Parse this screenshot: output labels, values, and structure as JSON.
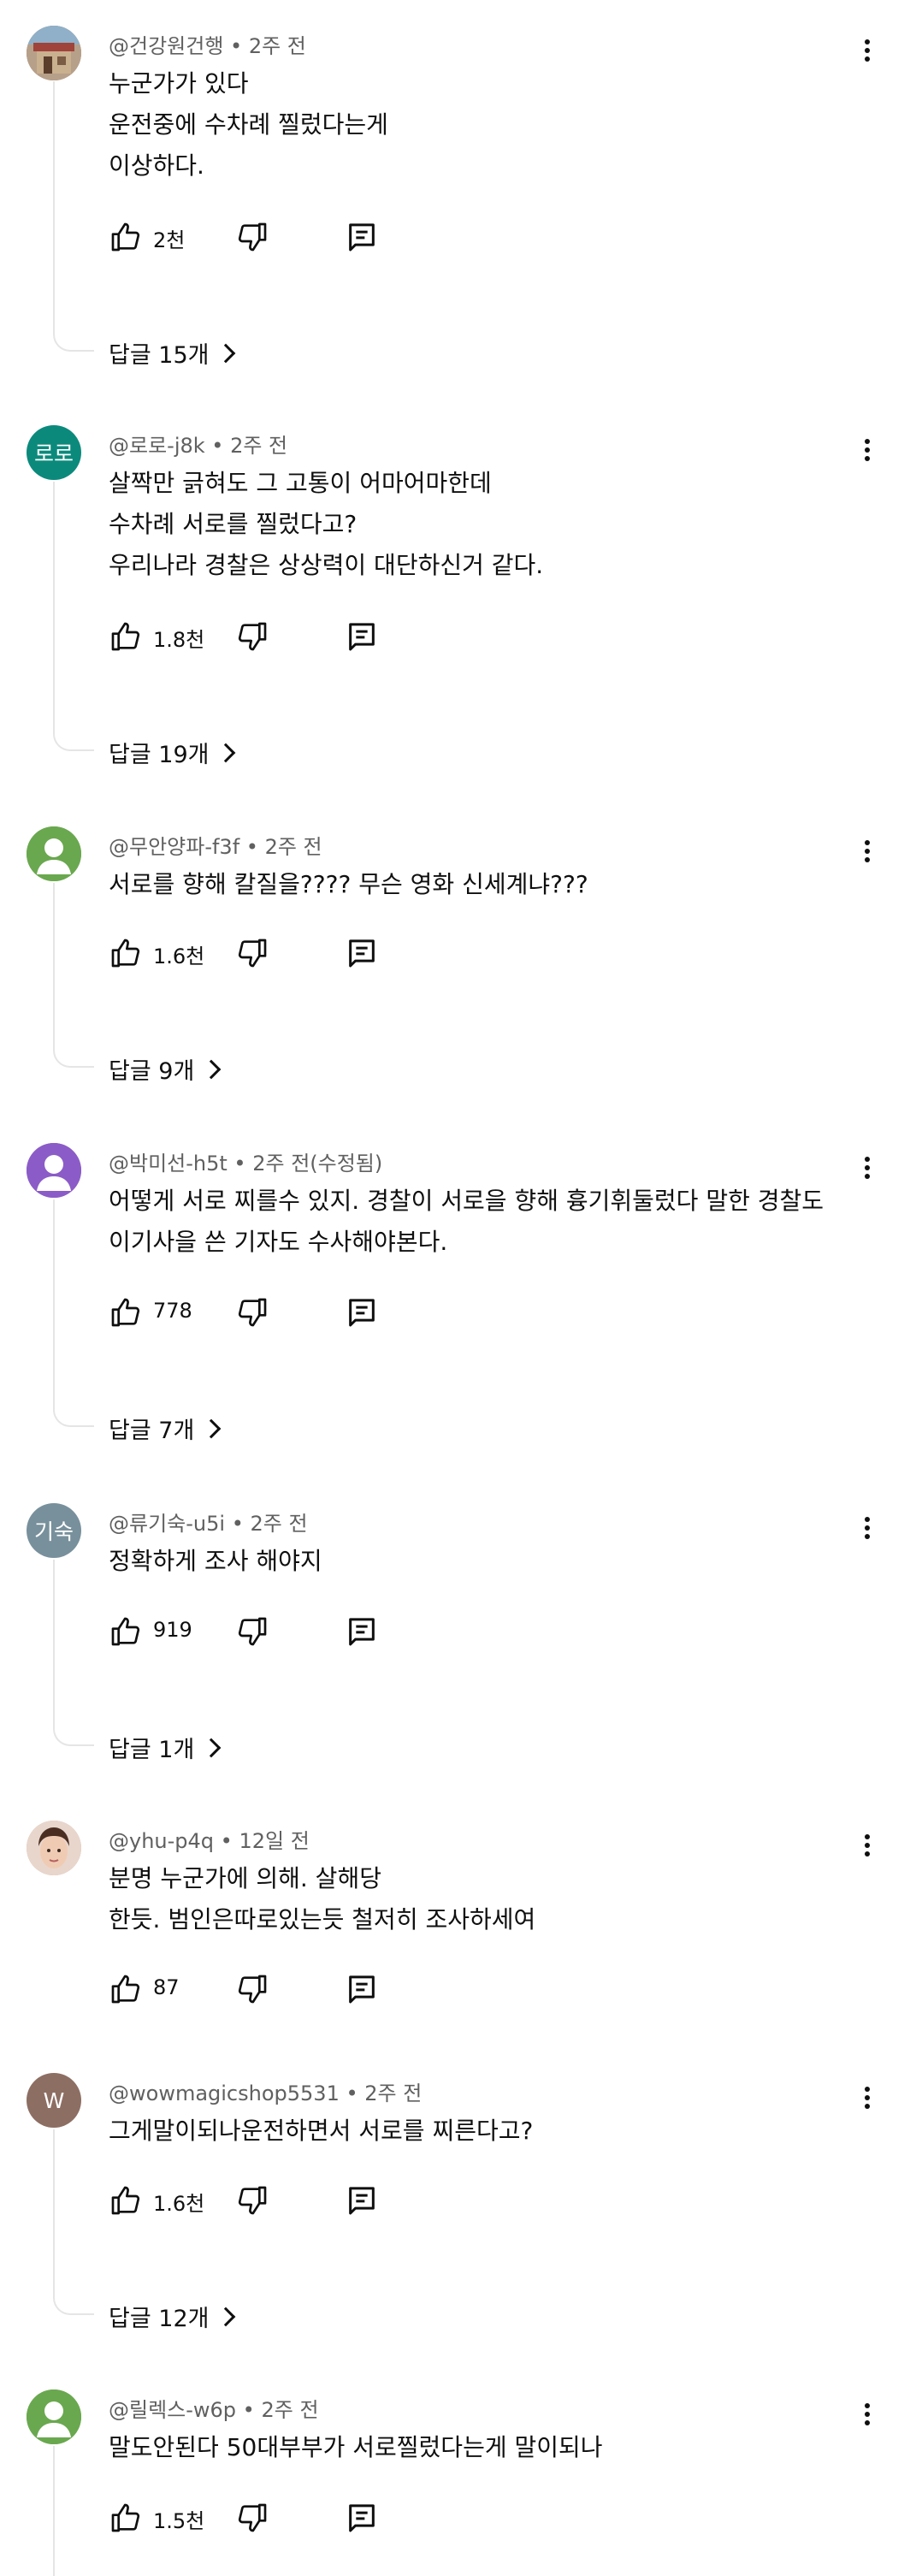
{
  "comments": [
    {
      "author": "@건강원건행",
      "time": "2주 전",
      "avatar_type": "photo-house",
      "avatar_color": "#8a6a5a",
      "lines": [
        "누군가가 있다",
        "운전중에 수차례 찔렀다는게",
        "이상하다."
      ],
      "likes": "2천",
      "replies_label": "답글 15개"
    },
    {
      "author": "@로로-j8k",
      "time": "2주 전",
      "avatar_type": "text",
      "avatar_text": "로로",
      "avatar_color": "#0b8a7c",
      "lines": [
        "살짝만 긁혀도 그 고통이 어마어마한데",
        "수차례 서로를 찔렀다고?",
        "우리나라 경찰은 상상력이 대단하신거 같다."
      ],
      "likes": "1.8천",
      "replies_label": "답글 19개"
    },
    {
      "author": "@무안양파-f3f",
      "time": "2주 전",
      "avatar_type": "person",
      "avatar_color": "#6aa84f",
      "lines": [
        "서로를 향해 칼질을???? 무슨 영화 신세계냐???"
      ],
      "likes": "1.6천",
      "replies_label": "답글 9개"
    },
    {
      "author": "@박미선-h5t",
      "time": "2주 전(수정됨)",
      "avatar_type": "person",
      "avatar_color": "#8b5cc7",
      "lines": [
        "어떻게 서로 찌를수 있지.  경찰이 서로을 향해  흉기휘둘렀다  말한 경찰도",
        "이기사을 쓴 기자도  수사해야본다."
      ],
      "likes": "778",
      "replies_label": "답글 7개"
    },
    {
      "author": "@류기숙-u5i",
      "time": "2주 전",
      "avatar_type": "text",
      "avatar_text": "기숙",
      "avatar_color": "#78909c",
      "lines": [
        "정확하게 조사 해야지"
      ],
      "likes": "919",
      "replies_label": "답글 1개"
    },
    {
      "author": "@yhu-p4q",
      "time": "12일 전",
      "avatar_type": "photo-face",
      "avatar_color": "#c9a48e",
      "lines": [
        "분명 누군가에 의해. 살해당",
        "한듯. 범인은따로있는듯  철저히 조사하세여"
      ],
      "likes": "87",
      "replies_label": ""
    },
    {
      "author": "@wowmagicshop5531",
      "time": "2주 전",
      "avatar_type": "text",
      "avatar_text": "W",
      "avatar_color": "#8d6e63",
      "lines": [
        "그게말이되나운전하면서 서로를 찌른다고?"
      ],
      "likes": "1.6천",
      "replies_label": "답글 12개"
    },
    {
      "author": "@릴렉스-w6p",
      "time": "2주 전",
      "avatar_type": "person",
      "avatar_color": "#6aa84f",
      "lines": [
        "말도안된다 50대부부가 서로찔렀다는게 말이되나"
      ],
      "likes": "1.5천",
      "replies_label": ""
    }
  ],
  "icons": {
    "like": "thumbs-up-icon",
    "dislike": "thumbs-down-icon",
    "reply": "reply-comment-icon",
    "more": "more-vert-icon",
    "replies_chevron": "chevron-right-icon"
  }
}
